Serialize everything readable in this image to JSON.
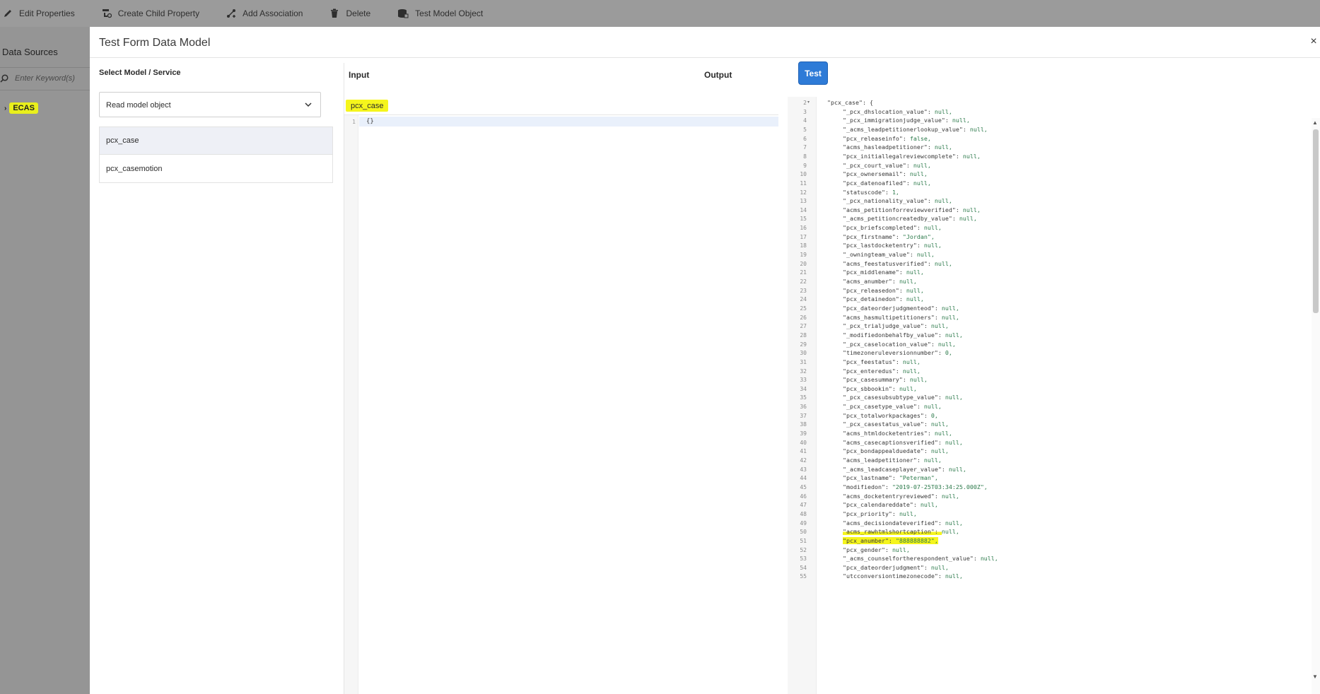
{
  "toolbar": {
    "items": [
      {
        "label": "Edit Properties",
        "icon": "pencil-icon"
      },
      {
        "label": "Create Child Property",
        "icon": "create-child-icon"
      },
      {
        "label": "Add Association",
        "icon": "association-icon"
      },
      {
        "label": "Delete",
        "icon": "trash-icon"
      },
      {
        "label": "Test Model Object",
        "icon": "test-model-icon"
      }
    ]
  },
  "left_rail": {
    "title": "Data Sources",
    "search_placeholder": "Enter Keyword(s)",
    "tree_root": "ECAS"
  },
  "modal": {
    "title": "Test Form Data Model",
    "close_glyph": "×",
    "select_label": "Select Model / Service",
    "select_value": "Read model object",
    "models": [
      "pcx_case",
      "pcx_casemotion"
    ],
    "input_label": "Input",
    "test_button": "Test",
    "output_label": "Output",
    "input_object": "pcx_case",
    "input_code": {
      "line_number": "1",
      "text": "{}"
    }
  },
  "output": {
    "lines": [
      {
        "n": "2",
        "fold": true,
        "key": "\"pcx_case\": {",
        "val": "",
        "indent": 0
      },
      {
        "n": "3",
        "key": "\"_pcx_dhslocation_value\": ",
        "val": "null,",
        "indent": 1
      },
      {
        "n": "4",
        "key": "\"_pcx_immigrationjudge_value\": ",
        "val": "null,",
        "indent": 1
      },
      {
        "n": "5",
        "key": "\"_acms_leadpetitionerlookup_value\": ",
        "val": "null,",
        "indent": 1
      },
      {
        "n": "6",
        "key": "\"pcx_releaseinfo\": ",
        "val": "false,",
        "indent": 1
      },
      {
        "n": "7",
        "key": "\"acms_hasleadpetitioner\": ",
        "val": "null,",
        "indent": 1
      },
      {
        "n": "8",
        "key": "\"pcx_initiallegalreviewcomplete\": ",
        "val": "null,",
        "indent": 1
      },
      {
        "n": "9",
        "key": "\"_pcx_court_value\": ",
        "val": "null,",
        "indent": 1
      },
      {
        "n": "10",
        "key": "\"pcx_ownersemail\": ",
        "val": "null,",
        "indent": 1
      },
      {
        "n": "11",
        "key": "\"pcx_datenoafiled\": ",
        "val": "null,",
        "indent": 1
      },
      {
        "n": "12",
        "key": "\"statuscode\": ",
        "val": "1,",
        "indent": 1
      },
      {
        "n": "13",
        "key": "\"_pcx_nationality_value\": ",
        "val": "null,",
        "indent": 1
      },
      {
        "n": "14",
        "key": "\"acms_petitionforreviewverified\": ",
        "val": "null,",
        "indent": 1
      },
      {
        "n": "15",
        "key": "\"_acms_petitioncreatedby_value\": ",
        "val": "null,",
        "indent": 1
      },
      {
        "n": "16",
        "key": "\"pcx_briefscompleted\": ",
        "val": "null,",
        "indent": 1
      },
      {
        "n": "17",
        "key": "\"pcx_firstname\": ",
        "val": "\"Jordan\",",
        "indent": 1
      },
      {
        "n": "18",
        "key": "\"pcx_lastdocketentry\": ",
        "val": "null,",
        "indent": 1
      },
      {
        "n": "19",
        "key": "\"_owningteam_value\": ",
        "val": "null,",
        "indent": 1
      },
      {
        "n": "20",
        "key": "\"acms_feestatusverified\": ",
        "val": "null,",
        "indent": 1
      },
      {
        "n": "21",
        "key": "\"pcx_middlename\": ",
        "val": "null,",
        "indent": 1
      },
      {
        "n": "22",
        "key": "\"acms_anumber\": ",
        "val": "null,",
        "indent": 1
      },
      {
        "n": "23",
        "key": "\"pcx_releasedon\": ",
        "val": "null,",
        "indent": 1
      },
      {
        "n": "24",
        "key": "\"pcx_detainedon\": ",
        "val": "null,",
        "indent": 1
      },
      {
        "n": "25",
        "key": "\"pcx_dateorderjudgmenteod\": ",
        "val": "null,",
        "indent": 1
      },
      {
        "n": "26",
        "key": "\"acms_hasmultipetitioners\": ",
        "val": "null,",
        "indent": 1
      },
      {
        "n": "27",
        "key": "\"_pcx_trialjudge_value\": ",
        "val": "null,",
        "indent": 1
      },
      {
        "n": "28",
        "key": "\"_modifiedonbehalfby_value\": ",
        "val": "null,",
        "indent": 1
      },
      {
        "n": "29",
        "key": "\"_pcx_caselocation_value\": ",
        "val": "null,",
        "indent": 1
      },
      {
        "n": "30",
        "key": "\"timezoneruleversionnumber\": ",
        "val": "0,",
        "indent": 1
      },
      {
        "n": "31",
        "key": "\"pcx_feestatus\": ",
        "val": "null,",
        "indent": 1
      },
      {
        "n": "32",
        "key": "\"pcx_enteredus\": ",
        "val": "null,",
        "indent": 1
      },
      {
        "n": "33",
        "key": "\"pcx_casesummary\": ",
        "val": "null,",
        "indent": 1
      },
      {
        "n": "34",
        "key": "\"pcx_sbbookin\": ",
        "val": "null,",
        "indent": 1
      },
      {
        "n": "35",
        "key": "\"_pcx_casesubsubtype_value\": ",
        "val": "null,",
        "indent": 1
      },
      {
        "n": "36",
        "key": "\"_pcx_casetype_value\": ",
        "val": "null,",
        "indent": 1
      },
      {
        "n": "37",
        "key": "\"pcx_totalworkpackages\": ",
        "val": "0,",
        "indent": 1
      },
      {
        "n": "38",
        "key": "\"_pcx_casestatus_value\": ",
        "val": "null,",
        "indent": 1
      },
      {
        "n": "39",
        "key": "\"acms_htmldocketentries\": ",
        "val": "null,",
        "indent": 1
      },
      {
        "n": "40",
        "key": "\"acms_casecaptionsverified\": ",
        "val": "null,",
        "indent": 1
      },
      {
        "n": "41",
        "key": "\"pcx_bondappealduedate\": ",
        "val": "null,",
        "indent": 1
      },
      {
        "n": "42",
        "key": "\"acms_leadpetitioner\": ",
        "val": "null,",
        "indent": 1
      },
      {
        "n": "43",
        "key": "\"_acms_leadcaseplayer_value\": ",
        "val": "null,",
        "indent": 1
      },
      {
        "n": "44",
        "key": "\"pcx_lastname\": ",
        "val": "\"Peterman\",",
        "indent": 1
      },
      {
        "n": "45",
        "key": "\"modifiedon\": ",
        "val": "\"2019-07-25T03:34:25.000Z\",",
        "indent": 1
      },
      {
        "n": "46",
        "key": "\"acms_docketentryreviewed\": ",
        "val": "null,",
        "indent": 1
      },
      {
        "n": "47",
        "key": "\"pcx_calendareddate\": ",
        "val": "null,",
        "indent": 1
      },
      {
        "n": "48",
        "key": "\"pcx_priority\": ",
        "val": "null,",
        "indent": 1
      },
      {
        "n": "49",
        "key": "\"acms_decisiondateverified\": ",
        "val": "null,",
        "indent": 1
      },
      {
        "n": "50",
        "key": "\"acms_rawhtmlshortcaption\": ",
        "val": "null,",
        "indent": 1,
        "hl": "partial"
      },
      {
        "n": "51",
        "key": "\"pcx_anumber\": ",
        "val": "\"888888882\",",
        "indent": 1,
        "hl": "full"
      },
      {
        "n": "52",
        "key": "\"pcx_gender\": ",
        "val": "null,",
        "indent": 1
      },
      {
        "n": "53",
        "key": "\"_acms_counselfortherespondent_value\": ",
        "val": "null,",
        "indent": 1
      },
      {
        "n": "54",
        "key": "\"pcx_dateorderjudgment\": ",
        "val": "null,",
        "indent": 1
      },
      {
        "n": "55",
        "key": "\"utcconversiontimezonecode\": ",
        "val": "null,",
        "indent": 1
      }
    ]
  },
  "colors": {
    "accent": "#2e7bd7",
    "highlight": "#f5f51c",
    "overlay": "#8f8f8f"
  }
}
